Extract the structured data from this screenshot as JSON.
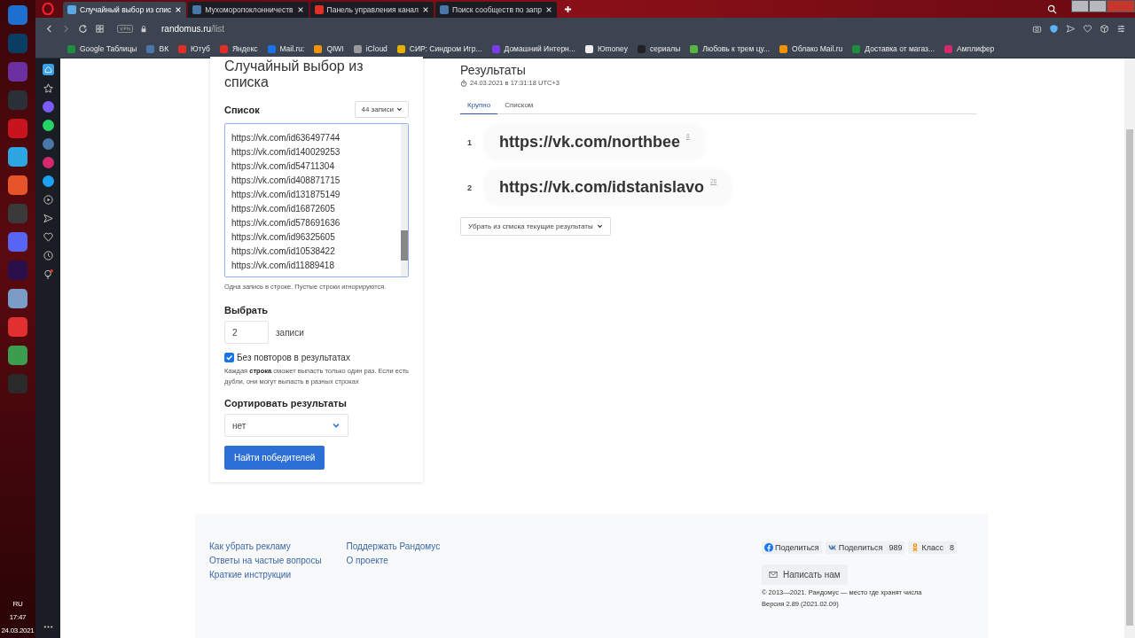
{
  "taskbar": {
    "language": "RU",
    "time": "17:47",
    "date": "24.03.2021"
  },
  "tabs": [
    {
      "label": "Случайный выбор из спис",
      "selected": true
    },
    {
      "label": "Мухоморопоклонничеств",
      "selected": false
    },
    {
      "label": "Панель управления канал",
      "selected": false
    },
    {
      "label": "Поиск сообществ по запр",
      "selected": false
    }
  ],
  "address": {
    "domain": "randomus.ru",
    "path": "/list"
  },
  "bookmarks": [
    "Google Таблицы",
    "ВК",
    "Ютуб",
    "Яндекс",
    "Mail.ru:",
    "QIWI",
    "iCloud",
    "СИР: Синдром Игр...",
    "Домашний Интерн...",
    "Юmoney",
    "сериалы",
    "Любовь к трем цу...",
    "Облако Mail.ru",
    "Доставка от магаз...",
    "Амплифер"
  ],
  "form": {
    "title": "Случайный выбор из списка",
    "list_label": "Список",
    "count_button": "44 записи",
    "lines": [
      "https://vk.com/id636497744",
      "https://vk.com/id140029253",
      "https://vk.com/id54711304",
      "https://vk.com/id408871715",
      "https://vk.com/id131875149",
      "https://vk.com/id16872605",
      "https://vk.com/id578691636",
      "https://vk.com/id96325605",
      "https://vk.com/id10538422",
      "https://vk.com/id11889418"
    ],
    "hint": "Одна запись в строке. Пустые строки игнорируются.",
    "choose_label": "Выбрать",
    "choose_value": "2",
    "choose_unit": "записи",
    "no_repeats": {
      "label": "Без повторов в результатах",
      "checked": true
    },
    "note": "Каждая **строка** сможет выпасть только один раз. Если есть дубли, они могут выпасть в разных строках",
    "sort_label": "Сортировать результаты",
    "sort_value": "нет",
    "submit": "Найти победителей"
  },
  "results": {
    "title": "Результаты",
    "timestamp": "24.03.2021 в 17:31:18 UTC+3",
    "tabs": [
      {
        "label": "Крупно",
        "selected": true
      },
      {
        "label": "Списком",
        "selected": false
      }
    ],
    "items": [
      {
        "index": "1",
        "value": "https://vk.com/northbee",
        "line": "8"
      },
      {
        "index": "2",
        "value": "https://vk.com/idstanislavo",
        "line": "26"
      }
    ],
    "remove_button": "Убрать из списка текущие результаты"
  },
  "footer": {
    "links_1": [
      "Как убрать рекламу",
      "Ответы на частые вопросы",
      "Краткие инструкции"
    ],
    "links_2": [
      "Поддержать Рандомус",
      "О проекте"
    ],
    "share": [
      {
        "kind": "facebook",
        "label": "Поделиться"
      },
      {
        "kind": "vk",
        "label": "Поделиться",
        "count": "989"
      },
      {
        "kind": "ok",
        "label": "Класс",
        "count": "8"
      }
    ],
    "contact": "Написать нам",
    "copyright": "© 2013—2021. Рандомус — место где хранят числа",
    "version": "Версия 2.89 (2021.02.09)"
  }
}
